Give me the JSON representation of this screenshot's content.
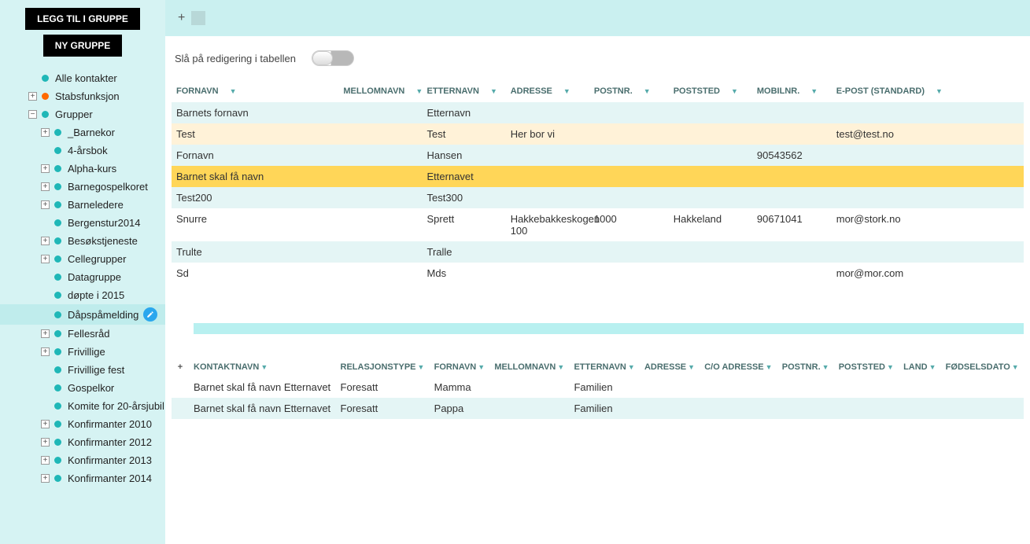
{
  "sidebar": {
    "add_to_group_label": "LEGG TIL I GRUPPE",
    "new_group_label": "NY GRUPPE",
    "roots": [
      {
        "label": "Alle kontakter",
        "dot": "teal",
        "toggle": ""
      },
      {
        "label": "Stabsfunksjon",
        "dot": "orange",
        "toggle": "+"
      },
      {
        "label": "Grupper",
        "dot": "teal",
        "toggle": "−"
      }
    ],
    "groups": [
      {
        "label": "_Barnekor",
        "dot": "teal",
        "toggle": "+",
        "level": 1
      },
      {
        "label": "4-årsbok",
        "dot": "teal",
        "toggle": "",
        "level": 1
      },
      {
        "label": "Alpha-kurs",
        "dot": "teal",
        "toggle": "+",
        "level": 1
      },
      {
        "label": "Barnegospelkoret",
        "dot": "teal",
        "toggle": "+",
        "level": 1
      },
      {
        "label": "Barneledere",
        "dot": "teal",
        "toggle": "+",
        "level": 1
      },
      {
        "label": "Bergenstur2014",
        "dot": "teal",
        "toggle": "",
        "level": 1
      },
      {
        "label": "Besøkstjeneste",
        "dot": "teal",
        "toggle": "+",
        "level": 1
      },
      {
        "label": "Cellegrupper",
        "dot": "teal",
        "toggle": "+",
        "level": 1
      },
      {
        "label": "Datagruppe",
        "dot": "teal",
        "toggle": "",
        "level": 1
      },
      {
        "label": "døpte i 2015",
        "dot": "teal",
        "toggle": "",
        "level": 1
      },
      {
        "label": "Dåpspåmelding",
        "dot": "teal",
        "toggle": "",
        "level": 1,
        "selected": true,
        "edit": true
      },
      {
        "label": "Fellesråd",
        "dot": "teal",
        "toggle": "+",
        "level": 1
      },
      {
        "label": "Frivillige",
        "dot": "teal",
        "toggle": "+",
        "level": 1
      },
      {
        "label": "Frivillige fest",
        "dot": "teal",
        "toggle": "",
        "level": 1
      },
      {
        "label": "Gospelkor",
        "dot": "teal",
        "toggle": "",
        "level": 1
      },
      {
        "label": "Komite for 20-årsjubil",
        "dot": "teal",
        "toggle": "",
        "level": 1
      },
      {
        "label": "Konfirmanter 2010",
        "dot": "teal",
        "toggle": "+",
        "level": 0
      },
      {
        "label": "Konfirmanter 2012",
        "dot": "teal",
        "toggle": "+",
        "level": 0
      },
      {
        "label": "Konfirmanter 2013",
        "dot": "teal",
        "toggle": "+",
        "level": 0
      },
      {
        "label": "Konfirmanter 2014",
        "dot": "teal",
        "toggle": "+",
        "level": 0
      }
    ]
  },
  "main": {
    "edit_toggle_label": "Slå på redigering i tabellen",
    "columns": [
      {
        "label": "FORNAVN"
      },
      {
        "label": "MELLOMNAVN"
      },
      {
        "label": "ETTERNAVN"
      },
      {
        "label": "ADRESSE"
      },
      {
        "label": "POSTNR."
      },
      {
        "label": "POSTSTED"
      },
      {
        "label": "MOBILNR."
      },
      {
        "label": "E-POST (STANDARD)"
      }
    ],
    "rows": [
      {
        "fornavn": "Barnets fornavn",
        "mellom": "",
        "etter": "Etternavn",
        "adr": "",
        "pnr": "",
        "psted": "",
        "mob": "",
        "ep": "",
        "cls": ""
      },
      {
        "fornavn": "Test",
        "mellom": "",
        "etter": "Test",
        "adr": "Her bor vi",
        "pnr": "",
        "psted": "",
        "mob": "",
        "ep": "test@test.no",
        "cls": "beige"
      },
      {
        "fornavn": "Fornavn",
        "mellom": "",
        "etter": "Hansen",
        "adr": "",
        "pnr": "",
        "psted": "",
        "mob": "90543562",
        "ep": "",
        "cls": ""
      },
      {
        "fornavn": "Barnet skal få navn",
        "mellom": "",
        "etter": "Etternavet",
        "adr": "",
        "pnr": "",
        "psted": "",
        "mob": "",
        "ep": "",
        "cls": "gold"
      },
      {
        "fornavn": "Test200",
        "mellom": "",
        "etter": "Test300",
        "adr": "",
        "pnr": "",
        "psted": "",
        "mob": "",
        "ep": "",
        "cls": ""
      },
      {
        "fornavn": "Snurre",
        "mellom": "",
        "etter": "Sprett",
        "adr": "Hakkebakkeskogen 100",
        "pnr": "1000",
        "psted": "Hakkeland",
        "mob": "90671041",
        "ep": "mor@stork.no",
        "cls": ""
      },
      {
        "fornavn": "Trulte",
        "mellom": "",
        "etter": "Tralle",
        "adr": "",
        "pnr": "",
        "psted": "",
        "mob": "",
        "ep": "",
        "cls": ""
      },
      {
        "fornavn": "Sd",
        "mellom": "",
        "etter": "Mds",
        "adr": "",
        "pnr": "",
        "psted": "",
        "mob": "",
        "ep": "mor@mor.com",
        "cls": ""
      }
    ]
  },
  "secondary": {
    "columns": [
      {
        "label": "KONTAKTNAVN"
      },
      {
        "label": "RELASJONSTYPE"
      },
      {
        "label": "FORNAVN"
      },
      {
        "label": "MELLOMNAVN"
      },
      {
        "label": "ETTERNAVN"
      },
      {
        "label": "ADRESSE"
      },
      {
        "label": "C/O ADRESSE"
      },
      {
        "label": "POSTNR."
      },
      {
        "label": "POSTSTED"
      },
      {
        "label": "LAND"
      },
      {
        "label": "FØDSELSDATO"
      }
    ],
    "rows": [
      {
        "kontakt": "Barnet skal få navn  Etternavet",
        "rel": "Foresatt",
        "for": "Mamma",
        "mel": "",
        "ett": "Familien",
        "adr": "",
        "co": "",
        "pnr": "",
        "pst": "",
        "land": "",
        "fdato": ""
      },
      {
        "kontakt": "Barnet skal få navn  Etternavet",
        "rel": "Foresatt",
        "for": "Pappa",
        "mel": "",
        "ett": "Familien",
        "adr": "",
        "co": "",
        "pnr": "",
        "pst": "",
        "land": "",
        "fdato": ""
      }
    ]
  }
}
